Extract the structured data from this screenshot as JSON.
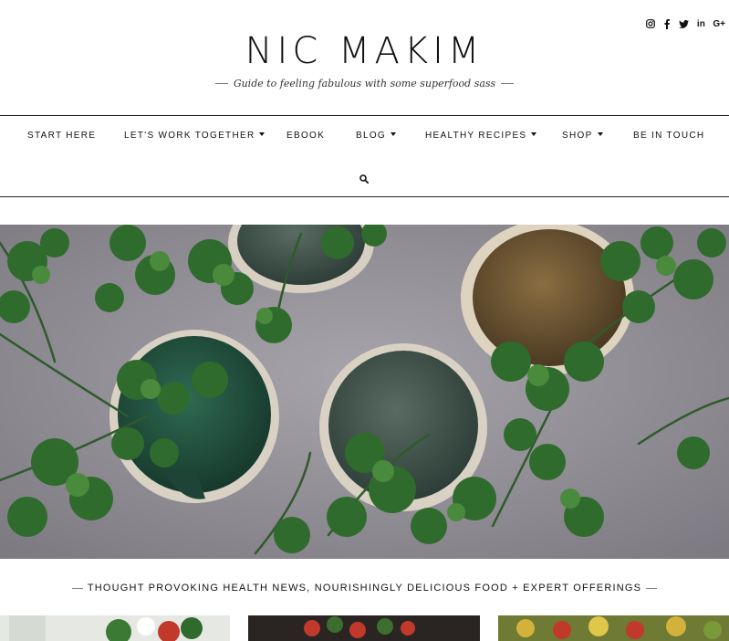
{
  "social": {
    "icons": [
      "instagram-icon",
      "facebook-icon",
      "twitter-icon",
      "linkedin-icon",
      "google-plus-icon"
    ],
    "linkedin_label": "in",
    "googleplus_label": "G+"
  },
  "header": {
    "title": "NIC MAKIM",
    "tagline": "Guide to feeling fabulous with some superfood sass"
  },
  "nav": {
    "items": [
      {
        "label": "START HERE",
        "dropdown": false
      },
      {
        "label": "LET'S WORK TOGETHER",
        "dropdown": true
      },
      {
        "label": "EBOOK",
        "dropdown": false
      },
      {
        "label": "BLOG",
        "dropdown": true
      },
      {
        "label": "HEALTHY RECIPES",
        "dropdown": true
      },
      {
        "label": "SHOP",
        "dropdown": true
      },
      {
        "label": "BE IN TOUCH",
        "dropdown": false
      }
    ],
    "search_icon": "search-icon"
  },
  "hero": {
    "image": "parsley-and-ceramic-cups-photo"
  },
  "section": {
    "title": "THOUGHT PROVOKING HEALTH NEWS, NOURISHINGLY DELICIOUS FOOD + EXPERT OFFERINGS"
  },
  "thumbnails": [
    "salad-photo",
    "tomato-dish-photo",
    "roasted-vegetables-photo"
  ],
  "colors": {
    "text": "#111111",
    "rule": "#222222",
    "hero_background": "#8e8b92"
  }
}
